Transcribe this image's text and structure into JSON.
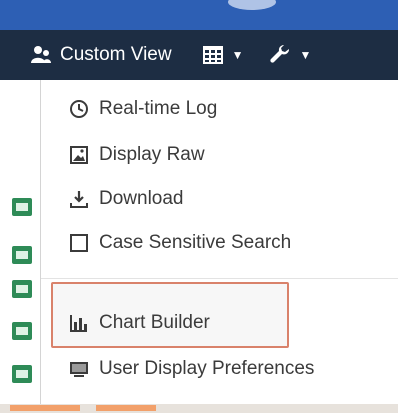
{
  "toolbar": {
    "custom_view_label": "Custom View",
    "icons": [
      "users-icon",
      "table-icon",
      "wrench-icon",
      "caret-down-icon"
    ]
  },
  "menu": {
    "items": [
      {
        "label": "Real-time Log",
        "icon": "clock-icon"
      },
      {
        "label": "Display Raw",
        "icon": "image-icon"
      },
      {
        "label": "Download",
        "icon": "download-icon"
      },
      {
        "label": "Case Sensitive Search",
        "icon": "checkbox-icon"
      },
      {
        "label": "Chart Builder",
        "icon": "bar-chart-icon",
        "highlighted": true
      },
      {
        "label": "User Display Preferences",
        "icon": "display-icon"
      }
    ]
  },
  "colors": {
    "toolbar_bg": "#1d2d43",
    "top_strip": "#2d5fb4",
    "highlight_border": "#d9826b",
    "row_icon": "#2e8b57"
  }
}
